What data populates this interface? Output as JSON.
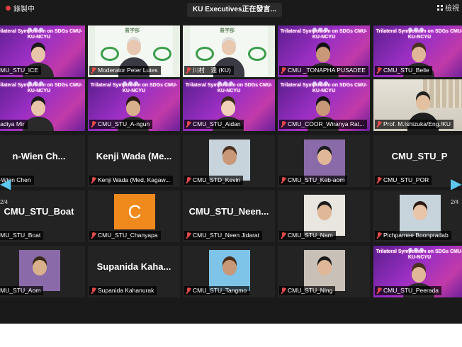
{
  "topbar": {
    "recording_label": "錄製中",
    "speaker_label": "KU Executives正在發言...",
    "view_label": "檢視"
  },
  "symposium_banner": "Trilateral Symposium on SDGs\nCMU-KU-NCYU",
  "kasetsart_sign": "農学部",
  "paging": {
    "left": "2/4",
    "right": "2/4"
  },
  "avatar_letter": "C",
  "tiles": [
    {
      "name": "CMU_STU_ICE",
      "muted": false,
      "big": ""
    },
    {
      "name": "Moderator Peter Lutes",
      "muted": true,
      "big": ""
    },
    {
      "name": "川村　達 (KU)",
      "muted": true,
      "big": ""
    },
    {
      "name": "CMU _TONAPHA PUSADEE",
      "muted": true,
      "big": ""
    },
    {
      "name": "CMU_STU_Belle",
      "muted": true,
      "big": ""
    },
    {
      "name": "Nadiya Mir",
      "muted": false,
      "big": ""
    },
    {
      "name": "CMU_STU_A-ngun",
      "muted": true,
      "big": ""
    },
    {
      "name": "CMU_STU_Aidan",
      "muted": true,
      "big": ""
    },
    {
      "name": "CMU_COOR_Wiranya Rat...",
      "muted": true,
      "big": ""
    },
    {
      "name": "Prof. M.Ishizuka/Eng./KU",
      "muted": true,
      "big": ""
    },
    {
      "name": "n-Wien Chen",
      "muted": false,
      "big": "n-Wien Ch..."
    },
    {
      "name": "Kenji Wada (Med, Kagaw...",
      "muted": true,
      "big": "Kenji Wada (Me..."
    },
    {
      "name": "CMU_STD_Kevin",
      "muted": true,
      "big": ""
    },
    {
      "name": "CMU_STU_Keb-aom",
      "muted": true,
      "big": ""
    },
    {
      "name": "CMU_STU_POR",
      "muted": true,
      "big": "CMU_STU_P"
    },
    {
      "name": "CMU_STU_Boat",
      "muted": false,
      "big": "CMU_STU_Boat"
    },
    {
      "name": "CMU_STU_Chanyapa",
      "muted": true,
      "big": ""
    },
    {
      "name": "CMU_STU_Neen Jidarat",
      "muted": true,
      "big": "CMU_STU_Neen..."
    },
    {
      "name": "CMU_STU_Nam",
      "muted": true,
      "big": ""
    },
    {
      "name": "Pichparnee Boonpradab",
      "muted": true,
      "big": ""
    },
    {
      "name": "CMU_STU_Aom",
      "muted": false,
      "big": ""
    },
    {
      "name": "Supanida Kahanurak",
      "muted": true,
      "big": "Supanida  Kaha..."
    },
    {
      "name": "CMU_STU_Tangmo",
      "muted": true,
      "big": ""
    },
    {
      "name": "CMU_STU_Ning",
      "muted": true,
      "big": ""
    },
    {
      "name": "CMU_STU_Peerada",
      "muted": true,
      "big": ""
    }
  ],
  "colors": {
    "background": "#1a1a1a",
    "symposium_purple": "#9a2fc4",
    "mute_red": "#e34b4b",
    "nav_arrow": "#5cc8f0",
    "avatar_orange": "#f08a1c"
  }
}
